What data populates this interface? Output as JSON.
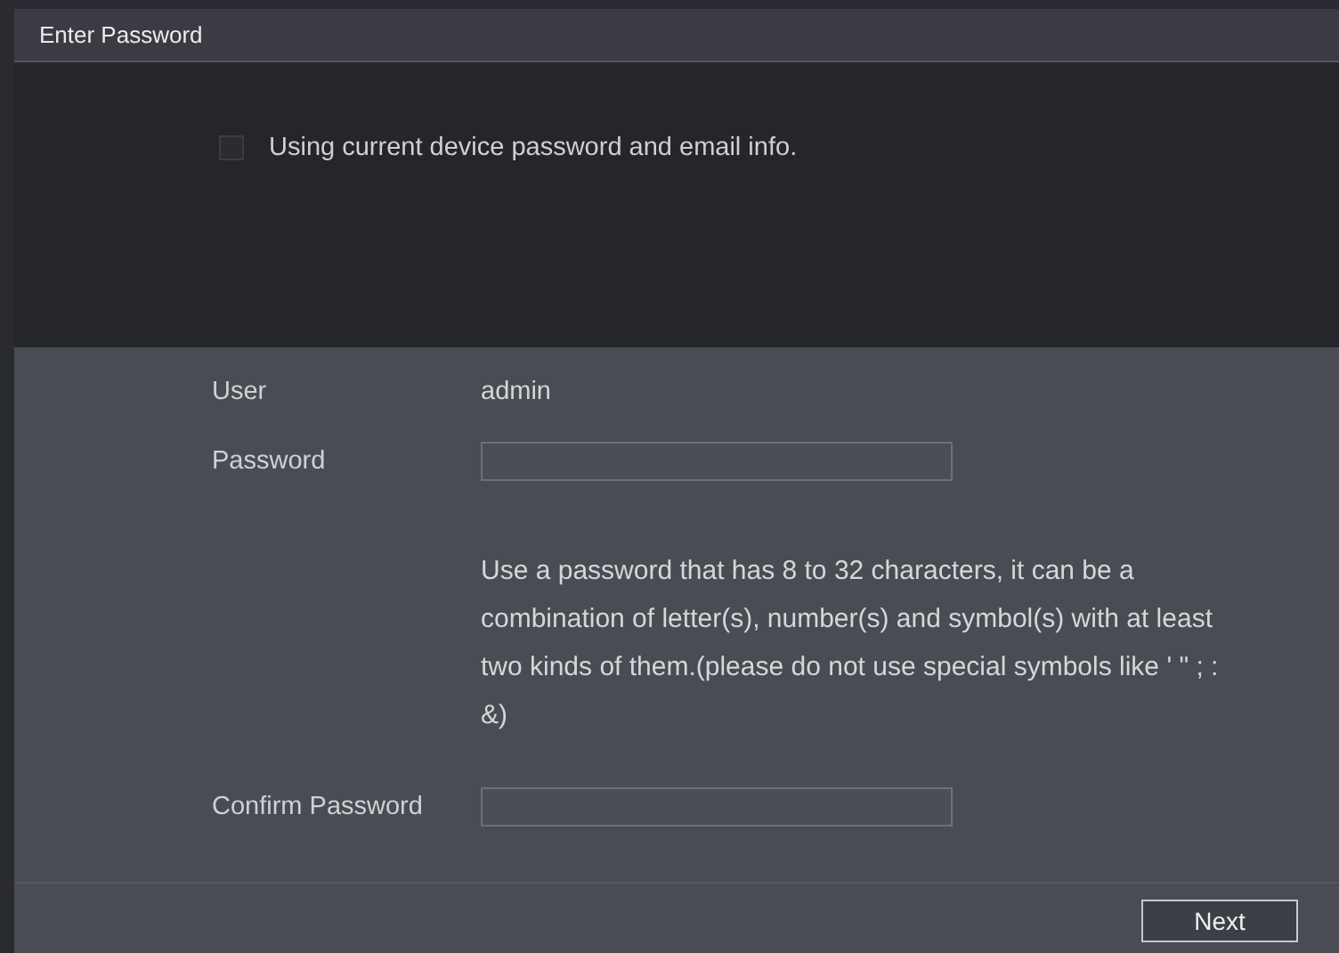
{
  "window": {
    "title": "Enter Password"
  },
  "use_current": {
    "label": "Using current device password and email info.",
    "checked": false
  },
  "user": {
    "label": "User",
    "value": "admin"
  },
  "password": {
    "label": "Password"
  },
  "hint": "Use a password that has 8 to 32 characters, it can be a combination of letter(s), number(s) and symbol(s) with at least two kinds of them.(please do not use special symbols like ' \" ; : &)",
  "confirm_password": {
    "label": "Confirm Password"
  },
  "buttons": [
    {
      "label": "Next"
    }
  ]
}
